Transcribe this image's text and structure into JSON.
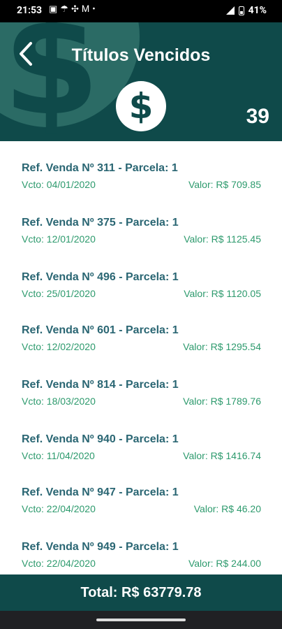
{
  "status_bar": {
    "time": "21:53",
    "battery": "41%",
    "left_icons": [
      "message-icon",
      "weather-icon",
      "fan-icon",
      "gmail-icon",
      "dot-icon"
    ]
  },
  "header": {
    "title": "Títulos Vencidos",
    "count": "39",
    "icons": [
      "back-arrow-icon",
      "dollar-icon"
    ]
  },
  "items": [
    {
      "title": "Ref. Venda Nº 311 - Parcela: 1",
      "date": "Vcto: 04/01/2020",
      "value": "Valor: R$ 709.85"
    },
    {
      "title": "Ref. Venda Nº 375 - Parcela: 1",
      "date": "Vcto: 12/01/2020",
      "value": "Valor: R$ 1125.45"
    },
    {
      "title": "Ref. Venda Nº 496 - Parcela: 1",
      "date": "Vcto: 25/01/2020",
      "value": "Valor: R$ 1120.05"
    },
    {
      "title": "Ref. Venda Nº 601 - Parcela: 1",
      "date": "Vcto: 12/02/2020",
      "value": "Valor: R$ 1295.54"
    },
    {
      "title": "Ref. Venda Nº 814 - Parcela: 1",
      "date": "Vcto: 18/03/2020",
      "value": "Valor: R$ 1789.76"
    },
    {
      "title": "Ref. Venda Nº 940 - Parcela: 1",
      "date": "Vcto: 11/04/2020",
      "value": "Valor: R$ 1416.74"
    },
    {
      "title": "Ref. Venda Nº 947 - Parcela: 1",
      "date": "Vcto: 22/04/2020",
      "value": "Valor: R$ 46.20"
    },
    {
      "title": "Ref. Venda Nº 949 - Parcela: 1",
      "date": "Vcto: 22/04/2020",
      "value": "Valor: R$ 244.00"
    }
  ],
  "footer": {
    "total": "Total: R$ 63779.78"
  },
  "colors": {
    "primary": "#0f4a4a",
    "title_text": "#2a6673",
    "accent_green": "#2d9a6d"
  }
}
